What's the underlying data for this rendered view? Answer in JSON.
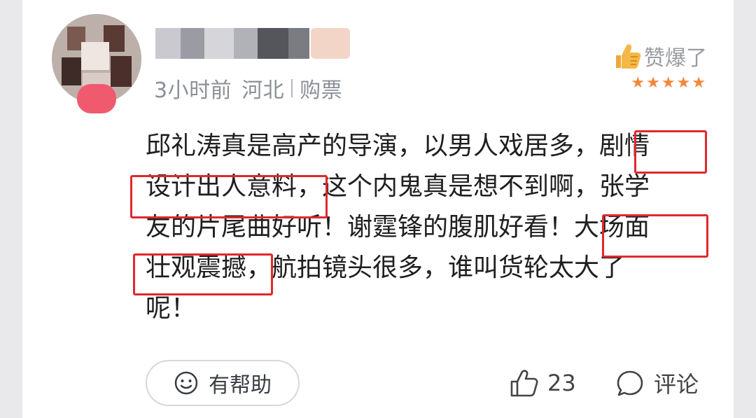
{
  "user": {
    "avatar_icon": "avatar-icon",
    "name": "",
    "time_ago": "3小时前",
    "location": "河北",
    "tag": "购票"
  },
  "rating": {
    "label": "赞爆了",
    "stars": "★★★★★",
    "star_color": "#f2873a"
  },
  "review": {
    "lines": [
      "邱礼涛真是高产的导演，以男人戏居多，剧情",
      "设计出人意料，这个内鬼真是想不到啊，张学",
      "友的片尾曲好听！谢霆锋的腹肌好看！大场面",
      "壮观震撼，航拍镜头很多，谁叫货轮太大了",
      "呢！"
    ],
    "highlight_color": "#e0282e"
  },
  "actions": {
    "helpful_label": "有帮助",
    "like_count": "23",
    "comment_label": "评论"
  }
}
